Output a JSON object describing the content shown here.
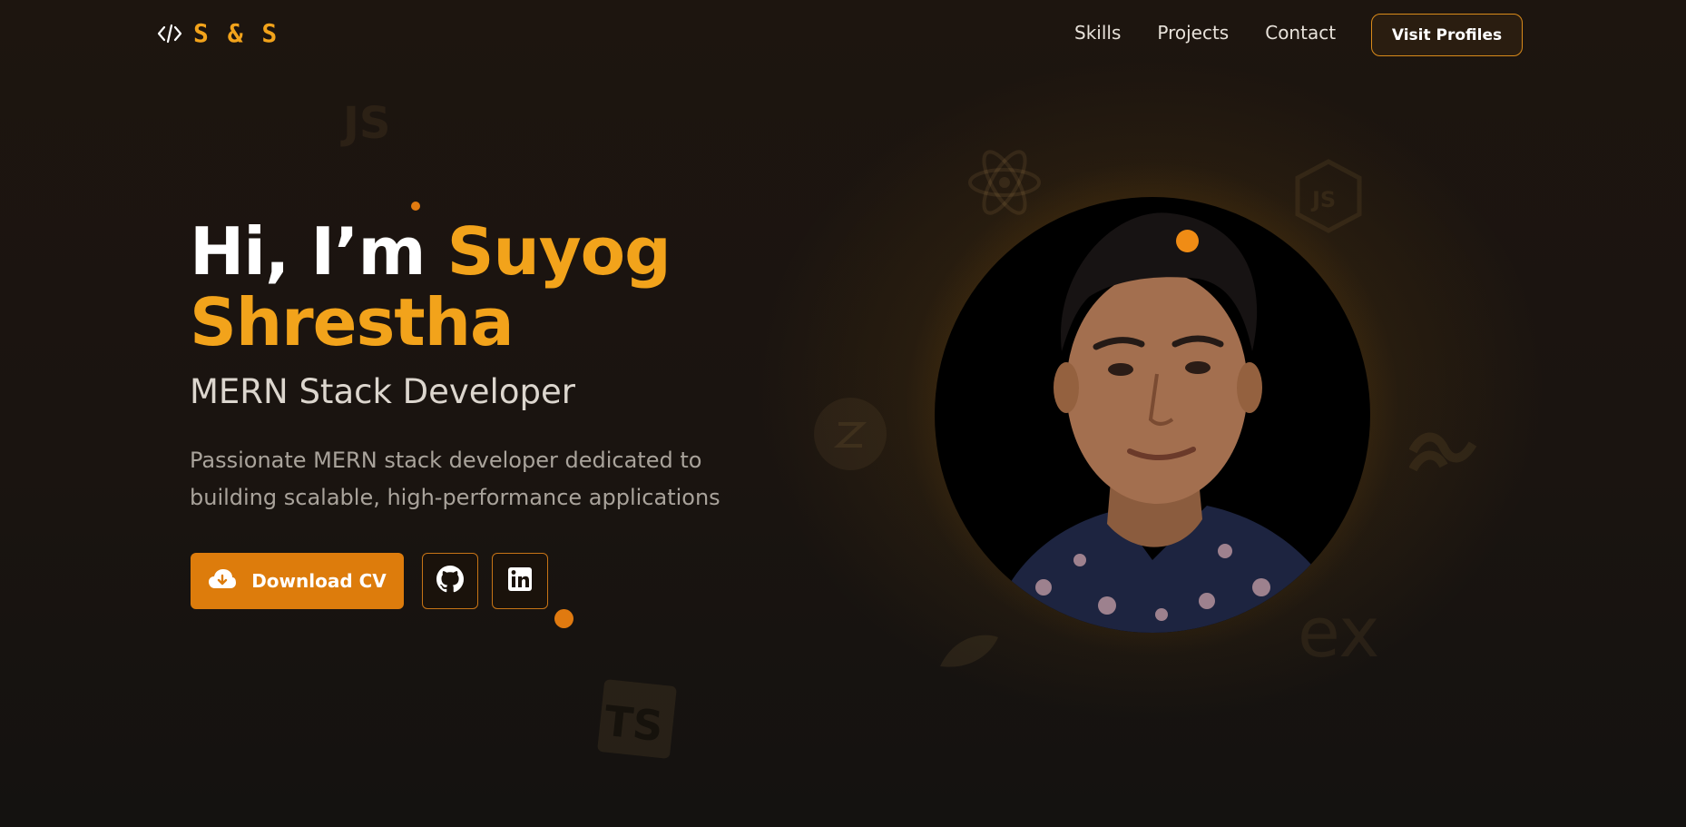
{
  "nav": {
    "logo_text": "S & S",
    "logo_icon": "code-icon",
    "links": [
      "Skills",
      "Projects",
      "Contact"
    ],
    "cta": "Visit Profiles"
  },
  "hero": {
    "greeting": "Hi, I’m ",
    "name_first": "Suyog",
    "name_last": "Shrestha",
    "role": "MERN Stack Developer",
    "description": "Passionate MERN stack developer dedicated to building scalable, high-performance applications",
    "download_label": "Download CV",
    "download_icon": "cloud-download-icon",
    "social_icons": [
      "github-icon",
      "linkedin-icon"
    ]
  },
  "background_icons": {
    "js_text": "JS",
    "ts_text": "TS",
    "ex_text": "ex"
  },
  "colors": {
    "accent": "#f2a31b",
    "button": "#dd7c0c",
    "background": "#1a1410"
  }
}
